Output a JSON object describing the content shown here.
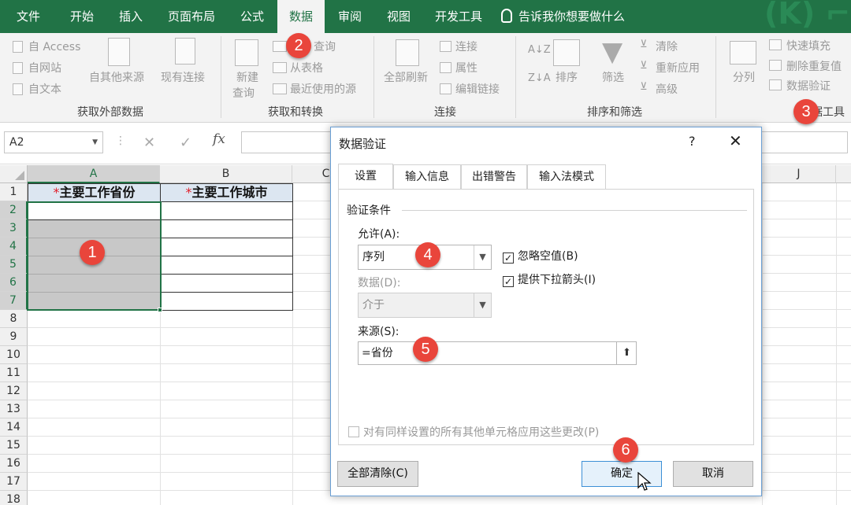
{
  "ribbon_tabs": [
    "文件",
    "开始",
    "插入",
    "页面布局",
    "公式",
    "数据",
    "审阅",
    "视图",
    "开发工具"
  ],
  "tell_me": "告诉我你想要做什么",
  "ribbon": {
    "external": {
      "from_access": "自 Access",
      "from_web": "自网站",
      "from_text": "自文本",
      "other_sources": "自其他来源",
      "existing_connections": "现有连接",
      "group_label": "获取外部数据"
    },
    "transform": {
      "new_query_1": "新建",
      "new_query_2": "查询",
      "show_query": "查询",
      "from_table": "从表格",
      "recent_sources": "最近使用的源",
      "group_label": "获取和转换"
    },
    "connections": {
      "refresh_all": "全部刷新",
      "connections": "连接",
      "properties": "属性",
      "edit_links": "编辑链接",
      "group_label": "连接"
    },
    "sort_filter": {
      "sort": "排序",
      "filter": "筛选",
      "clear": "清除",
      "reapply": "重新应用",
      "advanced": "高级",
      "group_label": "排序和筛选"
    },
    "data_tools": {
      "text_to_columns": "分列",
      "flash_fill": "快速填充",
      "remove_duplicates": "删除重复值",
      "data_validation": "数据验证",
      "group_label": "据工具"
    }
  },
  "formula_bar": {
    "name_box": "A2",
    "fx": "fx",
    "cancel": "✕",
    "enter": "✓"
  },
  "sheet": {
    "columns": [
      "A",
      "B",
      "C",
      "J"
    ],
    "rows": [
      "1",
      "2",
      "3",
      "4",
      "5",
      "6",
      "7",
      "8",
      "9",
      "10",
      "11",
      "12",
      "13",
      "14",
      "15",
      "16",
      "17",
      "18"
    ],
    "header_a": "主要工作省份",
    "header_b": "主要工作城市",
    "required_mark": "*"
  },
  "dialog": {
    "title": "数据验证",
    "help": "?",
    "close": "✕",
    "tabs": [
      "设置",
      "输入信息",
      "出错警告",
      "输入法模式"
    ],
    "section": "验证条件",
    "allow_label": "允许(A):",
    "allow_value": "序列",
    "data_label": "数据(D):",
    "data_value": "介于",
    "ignore_blank": "忽略空值(B)",
    "in_cell_dropdown": "提供下拉箭头(I)",
    "source_label": "来源(S):",
    "source_value": "=省份",
    "apply_all": "对有同样设置的所有其他单元格应用这些更改(P)",
    "clear_all": "全部清除(C)",
    "ok": "确定",
    "cancel": "取消"
  },
  "badges": [
    "1",
    "2",
    "3",
    "4",
    "5",
    "6"
  ],
  "colors": {
    "excel_green": "#217346",
    "badge_red": "#e9453b",
    "header_fill": "#dce6f1",
    "selected_fill": "#c8c8c8"
  }
}
